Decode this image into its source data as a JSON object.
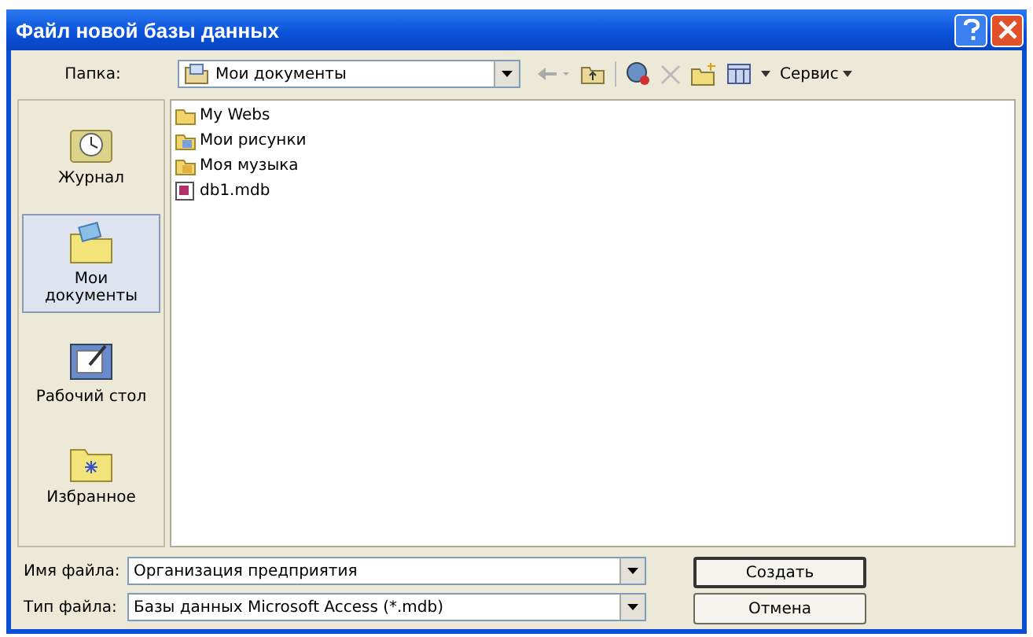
{
  "window": {
    "title": "Файл новой базы данных"
  },
  "folder": {
    "label": "Папка:",
    "value": "Мои документы"
  },
  "toolbar": {
    "tools_label": "Сервис"
  },
  "places": [
    {
      "label": "Журнал",
      "kind": "history",
      "selected": false
    },
    {
      "label": "Мои документы",
      "kind": "documents",
      "selected": true
    },
    {
      "label": "Рабочий стол",
      "kind": "desktop",
      "selected": false
    },
    {
      "label": "Избранное",
      "kind": "favorites",
      "selected": false
    }
  ],
  "files": [
    {
      "name": "My Webs",
      "kind": "folder"
    },
    {
      "name": "Мои рисунки",
      "kind": "pictures"
    },
    {
      "name": "Моя музыка",
      "kind": "music"
    },
    {
      "name": "db1.mdb",
      "kind": "database"
    }
  ],
  "filename": {
    "label": "Имя файла:",
    "value": "Организация предприятия"
  },
  "filetype": {
    "label": "Тип файла:",
    "value": "Базы данных Microsoft Access (*.mdb)"
  },
  "buttons": [
    "Создать",
    "Отмена"
  ]
}
